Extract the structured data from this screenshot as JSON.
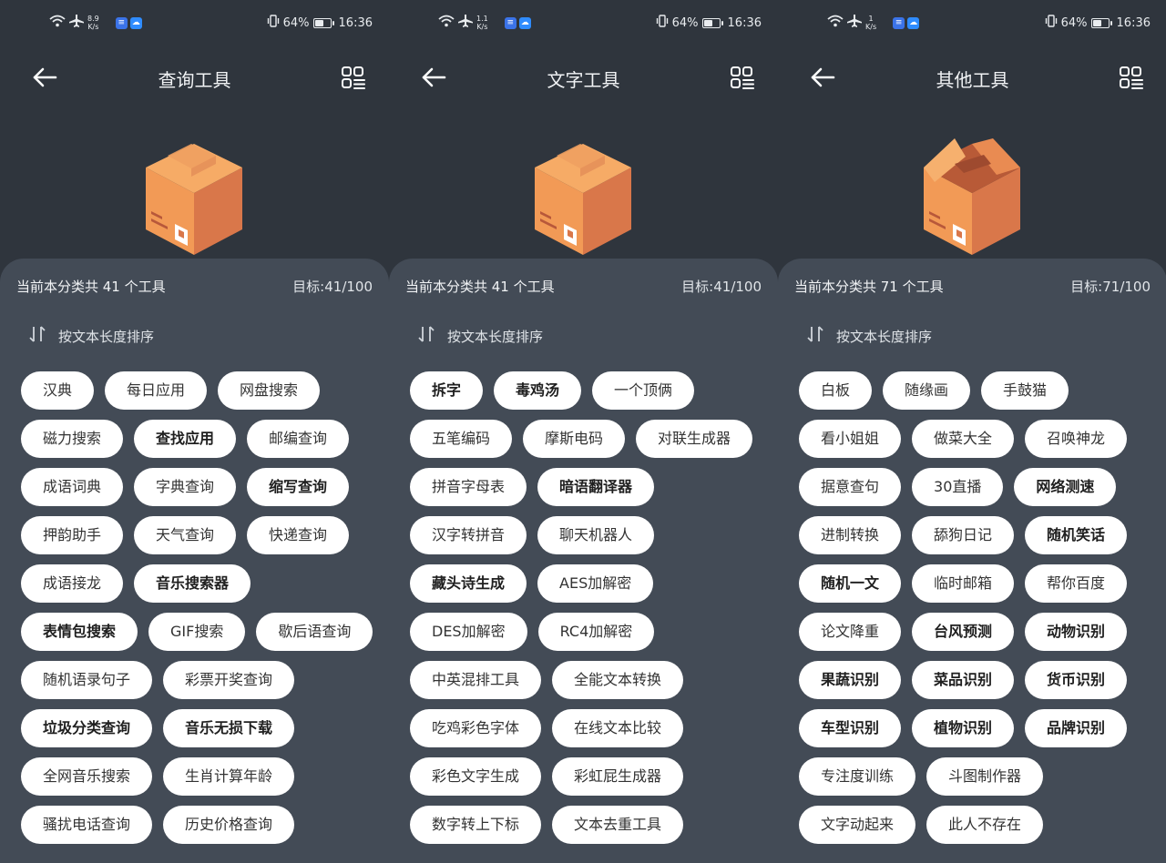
{
  "status": {
    "speeds": [
      "8.9",
      "1.1",
      "1"
    ],
    "speed_unit": "K/s",
    "battery": "64%",
    "time": "16:36"
  },
  "icons": {
    "back": "back-arrow-icon",
    "grid": "grid-list-icon",
    "sort": "sort-arrows-icon",
    "wifi": "wifi-icon",
    "airplane": "airplane-icon",
    "vibrate": "vibrate-icon",
    "battery": "battery-icon"
  },
  "colors": {
    "background": "#2f353d",
    "panel": "#434b56",
    "chip": "#ffffff",
    "box": "#e8884c"
  },
  "screens": [
    {
      "title": "查询工具",
      "summary": "当前本分类共 41 个工具",
      "goal": "目标:41/100",
      "sort_label": "按文本长度排序",
      "box_state": "closed",
      "rows": [
        [
          {
            "label": "汉典",
            "bold": false
          },
          {
            "label": "每日应用",
            "bold": false
          },
          {
            "label": "网盘搜索",
            "bold": false
          }
        ],
        [
          {
            "label": "磁力搜索",
            "bold": false
          },
          {
            "label": "查找应用",
            "bold": true
          },
          {
            "label": "邮编查询",
            "bold": false
          }
        ],
        [
          {
            "label": "成语词典",
            "bold": false
          },
          {
            "label": "字典查询",
            "bold": false
          },
          {
            "label": "缩写查询",
            "bold": true
          }
        ],
        [
          {
            "label": "押韵助手",
            "bold": false
          },
          {
            "label": "天气查询",
            "bold": false
          },
          {
            "label": "快递查询",
            "bold": false
          }
        ],
        [
          {
            "label": "成语接龙",
            "bold": false
          },
          {
            "label": "音乐搜索器",
            "bold": true
          }
        ],
        [
          {
            "label": "表情包搜索",
            "bold": true
          },
          {
            "label": "GIF搜索",
            "bold": false
          },
          {
            "label": "歇后语查询",
            "bold": false
          }
        ],
        [
          {
            "label": "随机语录句子",
            "bold": false
          },
          {
            "label": "彩票开奖查询",
            "bold": false
          }
        ],
        [
          {
            "label": "垃圾分类查询",
            "bold": true
          },
          {
            "label": "音乐无损下载",
            "bold": true
          }
        ],
        [
          {
            "label": "全网音乐搜索",
            "bold": false
          },
          {
            "label": "生肖计算年龄",
            "bold": false
          }
        ],
        [
          {
            "label": "骚扰电话查询",
            "bold": false
          },
          {
            "label": "历史价格查询",
            "bold": false
          }
        ]
      ]
    },
    {
      "title": "文字工具",
      "summary": "当前本分类共 41 个工具",
      "goal": "目标:41/100",
      "sort_label": "按文本长度排序",
      "box_state": "closed",
      "rows": [
        [
          {
            "label": "拆字",
            "bold": true
          },
          {
            "label": "毒鸡汤",
            "bold": true
          },
          {
            "label": "一个顶俩",
            "bold": false
          }
        ],
        [
          {
            "label": "五笔编码",
            "bold": false
          },
          {
            "label": "摩斯电码",
            "bold": false
          },
          {
            "label": "对联生成器",
            "bold": false
          }
        ],
        [
          {
            "label": "拼音字母表",
            "bold": false
          },
          {
            "label": "暗语翻译器",
            "bold": true
          }
        ],
        [
          {
            "label": "汉字转拼音",
            "bold": false
          },
          {
            "label": "聊天机器人",
            "bold": false
          }
        ],
        [
          {
            "label": "藏头诗生成",
            "bold": true
          },
          {
            "label": "AES加解密",
            "bold": false
          }
        ],
        [
          {
            "label": "DES加解密",
            "bold": false
          },
          {
            "label": "RC4加解密",
            "bold": false
          }
        ],
        [
          {
            "label": "中英混排工具",
            "bold": false
          },
          {
            "label": "全能文本转换",
            "bold": false
          }
        ],
        [
          {
            "label": "吃鸡彩色字体",
            "bold": false
          },
          {
            "label": "在线文本比较",
            "bold": false
          }
        ],
        [
          {
            "label": "彩色文字生成",
            "bold": false
          },
          {
            "label": "彩虹屁生成器",
            "bold": false
          }
        ],
        [
          {
            "label": "数字转上下标",
            "bold": false
          },
          {
            "label": "文本去重工具",
            "bold": false
          }
        ]
      ]
    },
    {
      "title": "其他工具",
      "summary": "当前本分类共 71 个工具",
      "goal": "目标:71/100",
      "sort_label": "按文本长度排序",
      "box_state": "open",
      "rows": [
        [
          {
            "label": "白板",
            "bold": false
          },
          {
            "label": "随缘画",
            "bold": false
          },
          {
            "label": "手鼓猫",
            "bold": false
          }
        ],
        [
          {
            "label": "看小姐姐",
            "bold": false
          },
          {
            "label": "做菜大全",
            "bold": false
          },
          {
            "label": "召唤神龙",
            "bold": false
          }
        ],
        [
          {
            "label": "据意查句",
            "bold": false
          },
          {
            "label": "30直播",
            "bold": false
          },
          {
            "label": "网络测速",
            "bold": true
          }
        ],
        [
          {
            "label": "进制转换",
            "bold": false
          },
          {
            "label": "舔狗日记",
            "bold": false
          },
          {
            "label": "随机笑话",
            "bold": true
          }
        ],
        [
          {
            "label": "随机一文",
            "bold": true
          },
          {
            "label": "临时邮箱",
            "bold": false
          },
          {
            "label": "帮你百度",
            "bold": false
          }
        ],
        [
          {
            "label": "论文降重",
            "bold": false
          },
          {
            "label": "台风预测",
            "bold": true
          },
          {
            "label": "动物识别",
            "bold": true
          }
        ],
        [
          {
            "label": "果蔬识别",
            "bold": true
          },
          {
            "label": "菜品识别",
            "bold": true
          },
          {
            "label": "货币识别",
            "bold": true
          }
        ],
        [
          {
            "label": "车型识别",
            "bold": true
          },
          {
            "label": "植物识别",
            "bold": true
          },
          {
            "label": "品牌识别",
            "bold": true
          }
        ],
        [
          {
            "label": "专注度训练",
            "bold": false
          },
          {
            "label": "斗图制作器",
            "bold": false
          }
        ],
        [
          {
            "label": "文字动起来",
            "bold": false
          },
          {
            "label": "此人不存在",
            "bold": false
          }
        ]
      ]
    }
  ]
}
